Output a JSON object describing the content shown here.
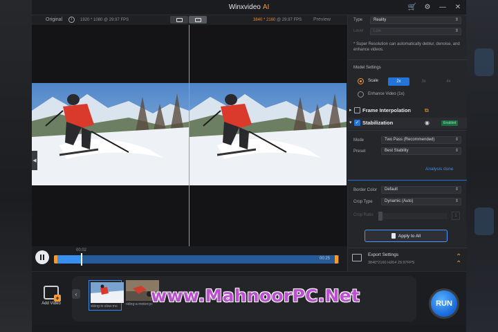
{
  "window": {
    "title": "Winxvideo",
    "title_accent": "AI",
    "accent_color": "#f29a36"
  },
  "titlebar_icons": [
    "cart-icon",
    "gear-icon",
    "minimize-icon",
    "close-icon"
  ],
  "preview_header": {
    "original_label": "Original",
    "info_glyph": "i",
    "original_resolution": "1920 * 1080 @ 29.97 FPS",
    "output_resolution": "3840 * 2160",
    "output_fps": "@ 29.97 FPS",
    "preview_label": "Preview"
  },
  "timeline": {
    "current_time": "00:02",
    "end_time": "00:25",
    "progress_percent": 9
  },
  "panel": {
    "type_label": "Type",
    "type_value": "Reality",
    "level_label": "Level",
    "level_value": "Low",
    "note": "* Super Resolution can automatically deblur, denoise, and enhance videos.",
    "model_settings_title": "Model Settings",
    "scale_label": "Scale",
    "scale_options": [
      "2x",
      "3x",
      "4x"
    ],
    "scale_selected": "2x",
    "enhance_label": "Enhance Video (1x)",
    "frame_interp_label": "Frame Interpolation",
    "stabilization_label": "Stabilization",
    "enabled_badge": "Enabled",
    "mode_label": "Mode",
    "mode_value": "Two Pass (Recommended)",
    "preset_label": "Preset",
    "preset_value": "Best Stability",
    "analysis_label": "Analysis done",
    "border_color_label": "Border Color",
    "border_color_value": "Default",
    "crop_type_label": "Crop Type",
    "crop_type_value": "Dynamic (Auto)",
    "crop_ratio_label": "Crop Ratio",
    "crop_ratio_value": "1",
    "apply_label": "Apply to All",
    "export_title": "Export Settings",
    "export_details": "3840*2160   H264   29.97FPS"
  },
  "bottom": {
    "add_video_label": "Add Video",
    "clips": [
      {
        "name": "skiing-in-slow-mo"
      },
      {
        "name": "riding-a-motorcyc"
      }
    ],
    "watermark": "www.MahnoorPC.Net",
    "run_label": "RUN"
  }
}
